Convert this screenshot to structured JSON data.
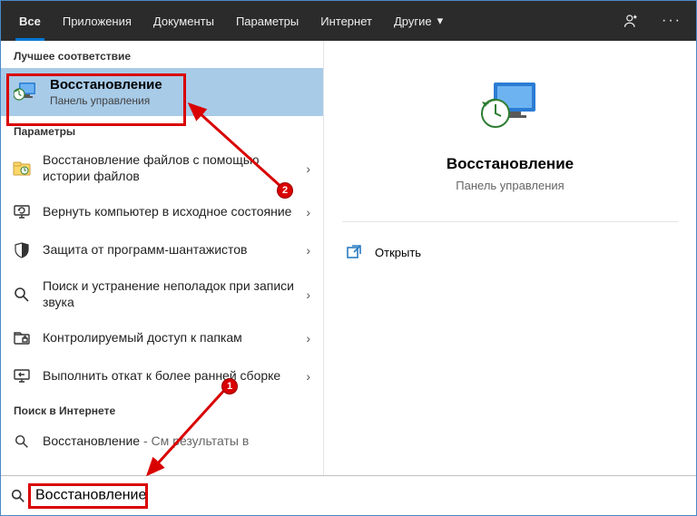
{
  "tabs": {
    "all": "Все",
    "apps": "Приложения",
    "docs": "Документы",
    "settings": "Параметры",
    "internet": "Интернет",
    "other": "Другие"
  },
  "sections": {
    "best_match": "Лучшее соответствие",
    "settings": "Параметры",
    "web": "Поиск в Интернете"
  },
  "best": {
    "title": "Восстановление",
    "subtitle": "Панель управления"
  },
  "settings_items": [
    {
      "icon": "file-history",
      "text": "Восстановление файлов с помощью истории файлов"
    },
    {
      "icon": "pc-reset",
      "text": "Вернуть компьютер в исходное состояние"
    },
    {
      "icon": "shield",
      "text": "Защита от программ-шантажистов"
    },
    {
      "icon": "search-fix",
      "text": "Поиск и устранение неполадок при записи звука"
    },
    {
      "icon": "folder-access",
      "text": "Контролируемый доступ к папкам"
    },
    {
      "icon": "rollback",
      "text": "Выполнить откат к более ранней сборке"
    }
  ],
  "web": {
    "label": "Восстановление",
    "suffix": " - См результаты в"
  },
  "preview": {
    "title": "Восстановление",
    "subtitle": "Панель управления",
    "open": "Открыть"
  },
  "search": {
    "value": "Восстановление"
  },
  "badges": {
    "one": "1",
    "two": "2"
  }
}
